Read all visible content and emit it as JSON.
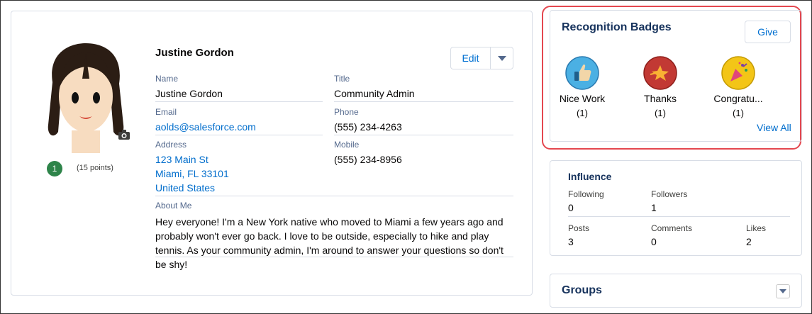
{
  "profile": {
    "display_name": "Justine Gordon",
    "edit_label": "Edit",
    "rank": "1",
    "points": "(15 points)",
    "fields": {
      "name_label": "Name",
      "name_value": "Justine Gordon",
      "title_label": "Title",
      "title_value": "Community Admin",
      "email_label": "Email",
      "email_value": "aolds@salesforce.com",
      "phone_label": "Phone",
      "phone_value": "(555) 234-4263",
      "address_label": "Address",
      "address_line1": "123 Main St",
      "address_line2": "Miami, FL 33101",
      "address_line3": "United States",
      "mobile_label": "Mobile",
      "mobile_value": "(555) 234-8956",
      "about_label": "About Me",
      "about_value": "Hey everyone! I'm a New York native who moved to Miami a few years ago and probably won't ever go back. I love to be outside, especially to hike and play tennis. As your community admin, I'm around to answer your questions so don't be shy!"
    }
  },
  "badges": {
    "title": "Recognition Badges",
    "give_label": "Give",
    "view_all_label": "View All",
    "items": [
      {
        "name": "Nice Work",
        "count": "(1)",
        "icon": "thumbs-up-icon",
        "color": "#4bb0e3"
      },
      {
        "name": "Thanks",
        "count": "(1)",
        "icon": "star-icon",
        "color": "#c23934"
      },
      {
        "name": "Congratu...",
        "count": "(1)",
        "icon": "party-popper-icon",
        "color": "#f3c517"
      }
    ]
  },
  "influence": {
    "title": "Influence",
    "following_label": "Following",
    "following_value": "0",
    "followers_label": "Followers",
    "followers_value": "1",
    "posts_label": "Posts",
    "posts_value": "3",
    "comments_label": "Comments",
    "comments_value": "0",
    "likes_label": "Likes",
    "likes_value": "2"
  },
  "groups": {
    "title": "Groups"
  },
  "colors": {
    "link": "#006dcc",
    "highlight": "#e4474f",
    "rank_badge": "#2e844a"
  }
}
